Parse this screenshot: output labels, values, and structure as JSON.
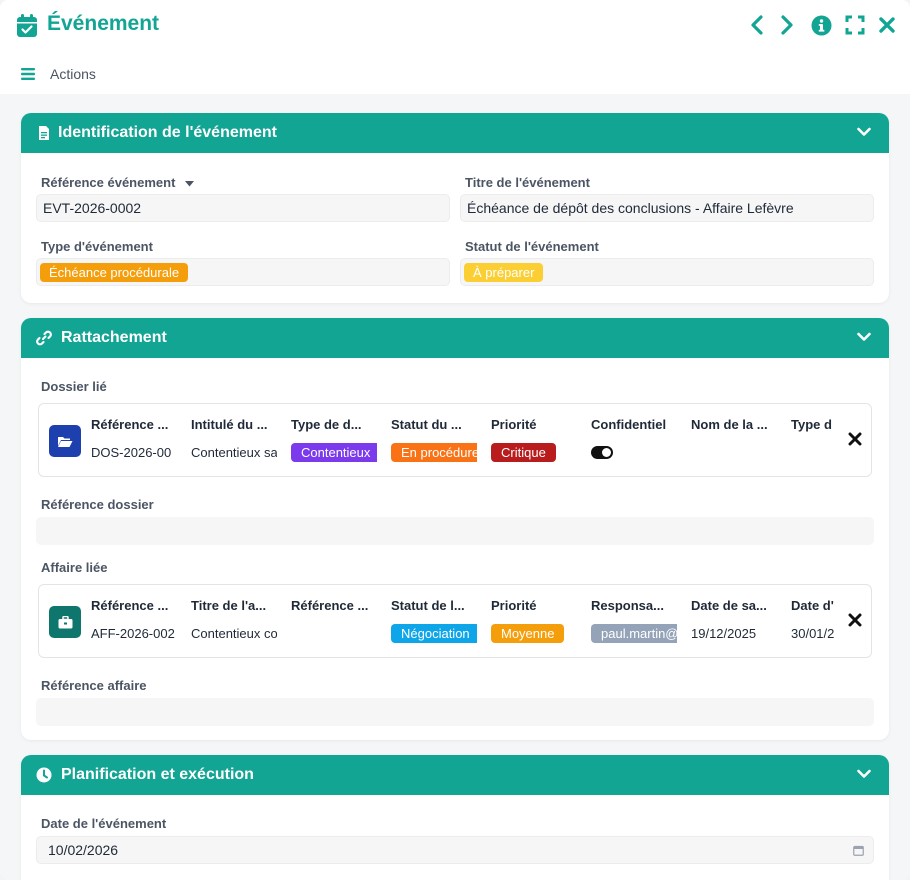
{
  "window": {
    "title": "Événement",
    "actions_label": "Actions"
  },
  "colors": {
    "accent": "#12a594",
    "badge_procedural": "#f59e0b",
    "badge_a_preparer": "#fbcf33",
    "badge_contentieux": "#7c3aed",
    "badge_en_procedure": "#f97316",
    "badge_critique": "#b91c1c",
    "badge_negociation": "#0ea5e9",
    "badge_moyenne": "#f59e0b",
    "badge_user": "#94a3b8"
  },
  "identification": {
    "title": "Identification de l'événement",
    "ref_label": "Référence événement",
    "ref_value": "EVT-2026-0002",
    "titre_label": "Titre de l'événement",
    "titre_value": "Échéance de dépôt des conclusions - Affaire Lefèvre",
    "type_label": "Type d'événement",
    "type_value": "Échéance procédurale",
    "statut_label": "Statut de l'événement",
    "statut_value": "À préparer"
  },
  "rattachement": {
    "title": "Rattachement",
    "dossier_label": "Dossier lié",
    "dossier": {
      "icon": "folder-open-icon",
      "headers": [
        "Référence dossier",
        "Intitulé du dossier",
        "Type de dossier",
        "Statut du dossier",
        "Priorité",
        "Confidentiel",
        "Nom de la partie",
        "Type de"
      ],
      "headers_display": [
        "Référence ...",
        "Intitulé du ...",
        "Type de d...",
        "Statut du ...",
        "Priorité",
        "Confidentiel",
        "Nom de la ...",
        "Type d"
      ],
      "values": [
        "DOS-2026-00",
        "Contentieux sa",
        "Contentieux",
        "En procédure",
        "Critique",
        "",
        "",
        ""
      ]
    },
    "ref_dossier_label": "Référence dossier",
    "ref_dossier_value": "",
    "affaire_label": "Affaire liée",
    "affaire": {
      "icon": "briefcase-icon",
      "headers_display": [
        "Référence ...",
        "Titre de l'a...",
        "Référence ...",
        "Statut de l...",
        "Priorité",
        "Responsa...",
        "Date de sa...",
        "Date d'"
      ],
      "values": [
        "AFF-2026-002",
        "Contentieux co",
        "",
        "Négociation",
        "Moyenne",
        "paul.martin@",
        "19/12/2025",
        "30/01/2"
      ]
    },
    "ref_affaire_label": "Référence affaire",
    "ref_affaire_value": ""
  },
  "planification": {
    "title": "Planification et exécution",
    "date_label": "Date de l'événement",
    "date_value": "10/02/2026"
  }
}
